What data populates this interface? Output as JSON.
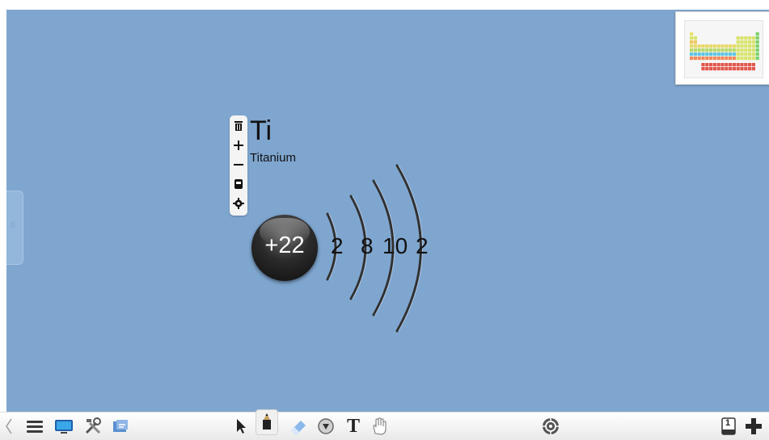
{
  "element": {
    "symbol": "Ti",
    "name": "Titanium",
    "nucleus_charge": "+22"
  },
  "shells": [
    "2",
    "8",
    "10",
    "2"
  ],
  "element_toolbar": [
    "trash-icon",
    "plus-icon",
    "minus-icon",
    "card-icon",
    "gear-icon"
  ],
  "bottom_toolbar": {
    "left": [
      "collapse-chevron-icon",
      "menu-icon",
      "display-icon",
      "tools-icon",
      "clipboard-icon"
    ],
    "center": [
      "select-arrow-icon",
      "pen-icon",
      "eraser-icon",
      "shape-icon",
      "text-icon",
      "hand-icon"
    ],
    "right": [
      "target-icon",
      "page-icon",
      "add-page-icon"
    ],
    "page_number": "1",
    "text_tool_glyph": "T"
  },
  "colors": {
    "canvas": "#7fa6cf",
    "nucleus": "#1a1a1a"
  }
}
